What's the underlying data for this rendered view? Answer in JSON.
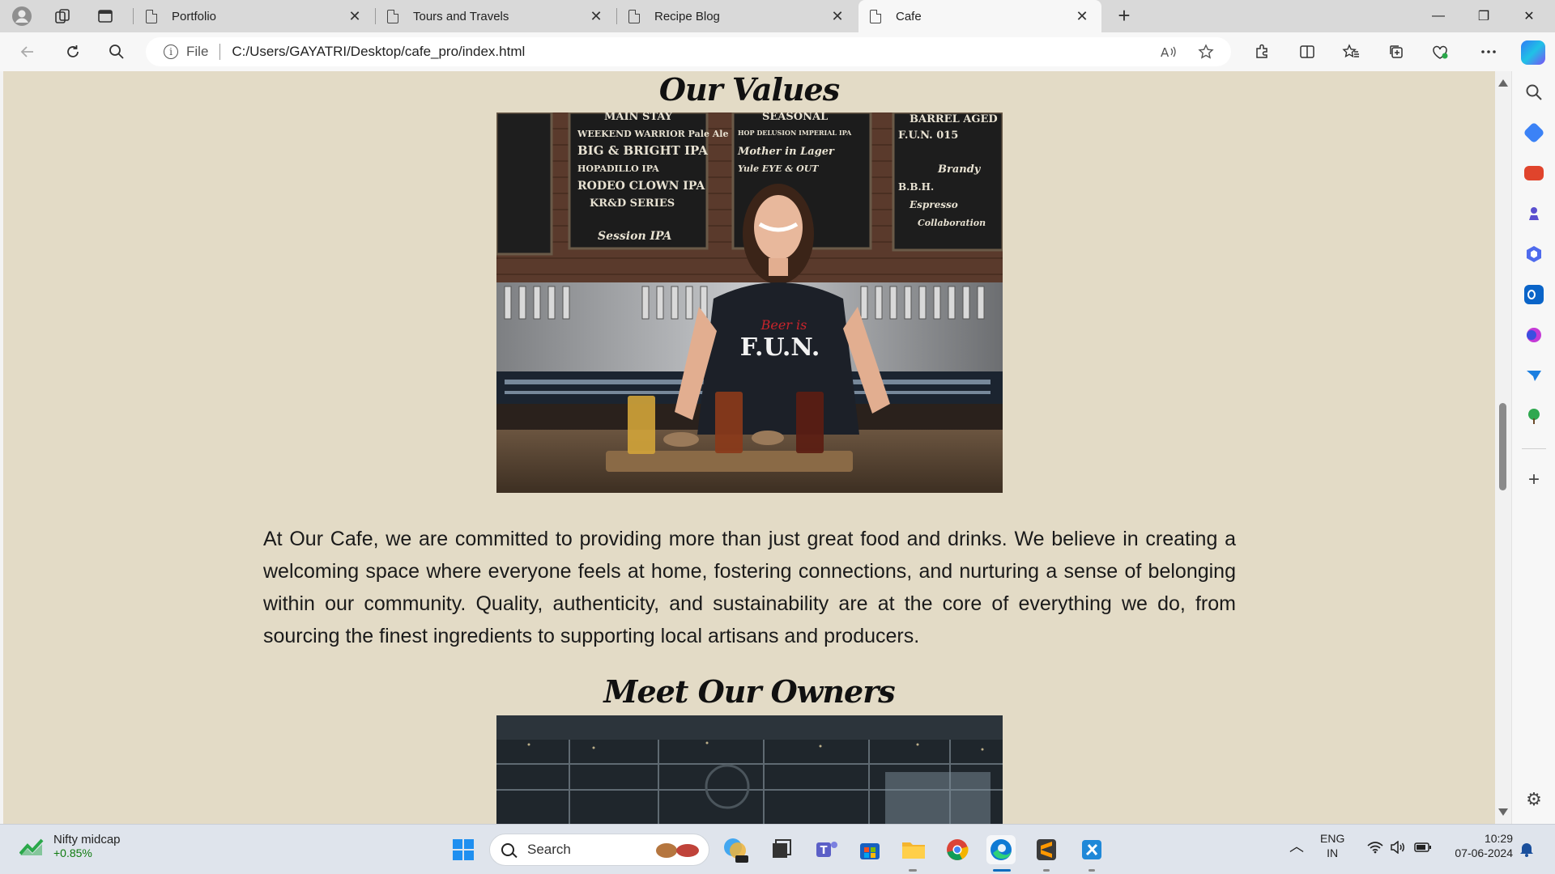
{
  "browser": {
    "tabs": [
      {
        "label": "Portfolio",
        "active": false
      },
      {
        "label": "Tours and Travels",
        "active": false
      },
      {
        "label": "Recipe Blog",
        "active": false
      },
      {
        "label": "Cafe",
        "active": true
      }
    ],
    "tab_close_glyph": "✕",
    "new_tab_glyph": "+",
    "window_controls": {
      "minimize": "—",
      "restore": "❐",
      "close": "✕"
    },
    "address": {
      "scheme_label": "File",
      "url": "C:/Users/GAYATRI/Desktop/cafe_pro/index.html",
      "info_glyph": "i"
    }
  },
  "page": {
    "values_heading": "Our Values",
    "values_text": "At Our Cafe, we are committed to providing more than just great food and drinks. We believe in creating a welcoming space where everyone feels at home, fostering connections, and nurturing a sense of belonging within our community. Quality, authenticity, and sustainability are at the core of everything we do, from sourcing the finest ingredients to supporting local artisans and producers.",
    "owners_heading": "Meet Our Owners",
    "photo1_menu": [
      "MAIN STAY",
      "SEASONAL",
      "BARREL AGED",
      "WEEKEND WARRIOR Pale Ale",
      "BIG & BRIGHT IPA",
      "HOPADILLO IPA",
      "RODEO CLOWN IPA",
      "KR&D SERIES",
      "Session IPA",
      "Mother in Lager",
      "Yule EYE & OUT",
      "HOP DELUSION IMPERIAL IPA",
      "F.U.N. 015",
      "B.B.H.",
      "Espresso",
      "Collaboration",
      "Brandy"
    ],
    "photo1_shirt": "F.U.N.",
    "photo1_shirt_script": "Beer is"
  },
  "taskbar": {
    "widget_title": "Nifty midcap",
    "widget_value": "+0.85%",
    "search_placeholder": "Search",
    "lang_primary": "ENG",
    "lang_secondary": "IN",
    "time": "10:29",
    "date": "07-06-2024"
  }
}
